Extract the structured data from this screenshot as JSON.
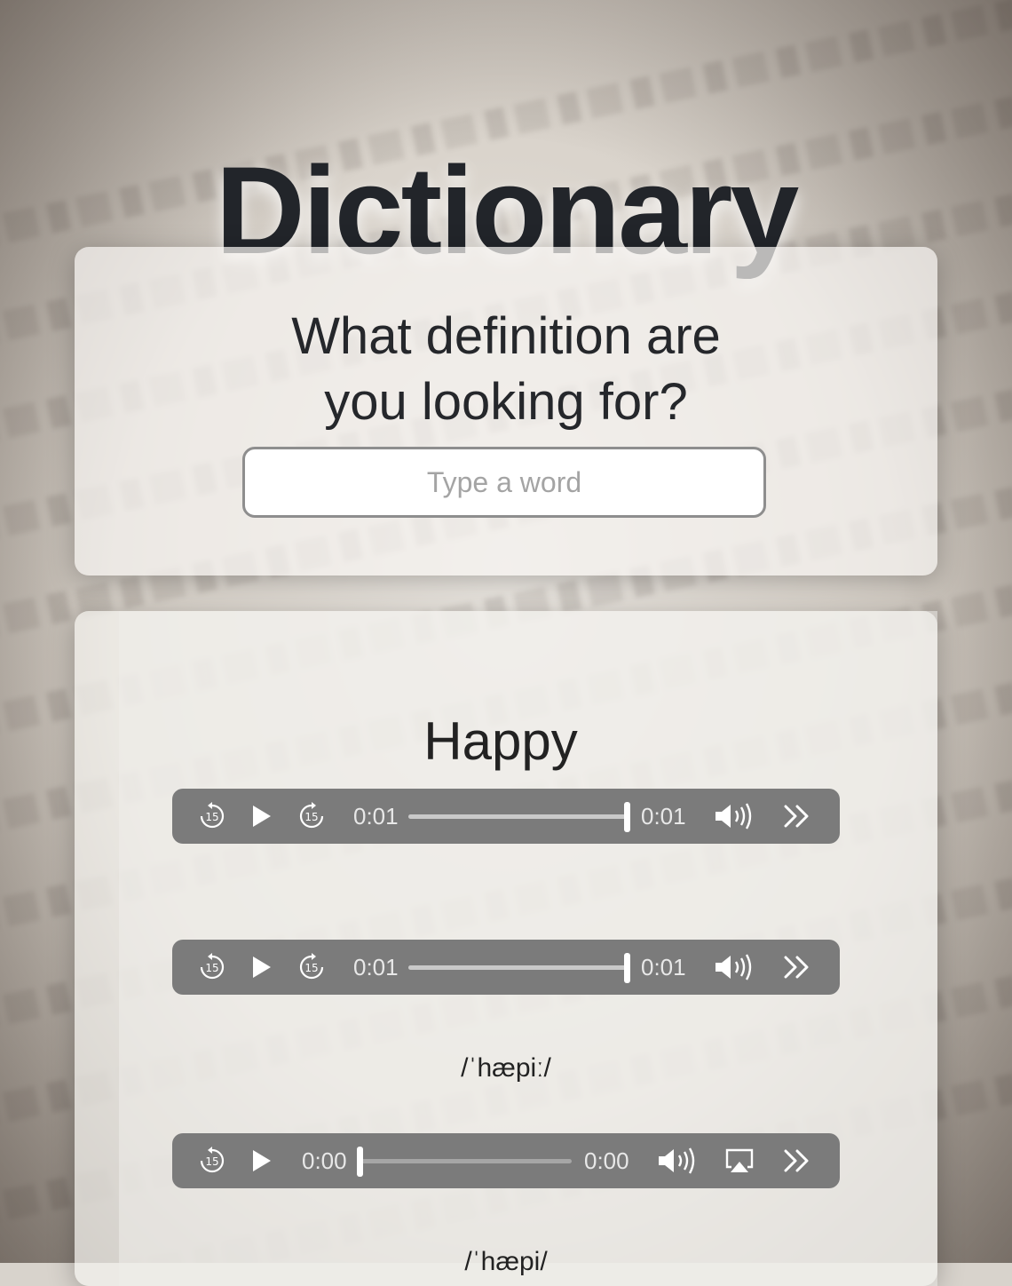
{
  "app": {
    "title": "Dictionary"
  },
  "search": {
    "heading": "What definition are you looking for?",
    "placeholder": "Type a word",
    "value": ""
  },
  "result": {
    "word": "Happy",
    "players": [
      {
        "current_time": "0:01",
        "duration": "0:01",
        "progress": 1.0,
        "has_skip_buttons": true,
        "has_airplay": false
      },
      {
        "current_time": "0:01",
        "duration": "0:01",
        "progress": 1.0,
        "has_skip_buttons": true,
        "has_airplay": false
      },
      {
        "current_time": "0:00",
        "duration": "0:00",
        "progress": 0.0,
        "has_skip_buttons": false,
        "has_airplay": true
      }
    ],
    "phonetics": [
      "/ˈhæpiː/",
      "/ˈhæpi/"
    ]
  },
  "icons": {
    "rewind": "rewind-15-icon",
    "play": "play-icon",
    "forward": "forward-15-icon",
    "volume": "volume-icon",
    "airplay": "airplay-icon",
    "more": "chevrons-right-icon"
  },
  "colors": {
    "player_bg": "#7b7b7b",
    "title": "#22252a"
  }
}
